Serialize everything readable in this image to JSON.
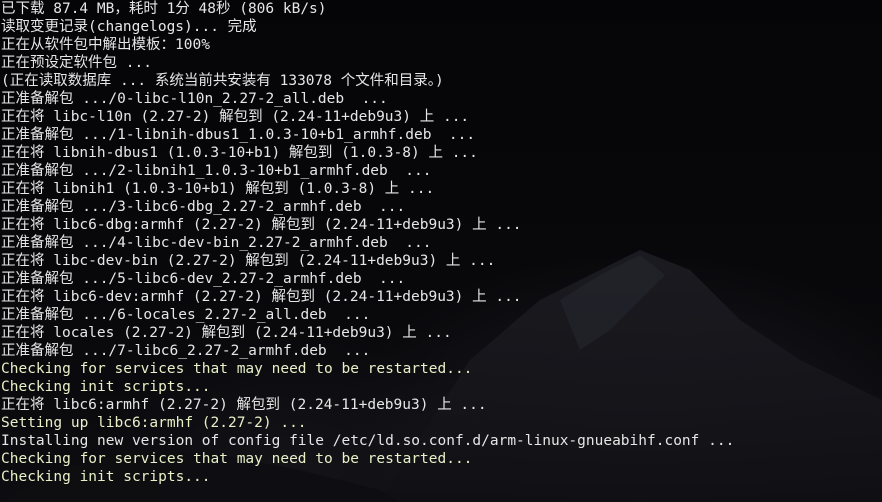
{
  "terminal": {
    "lines": [
      {
        "text": "已下载 87.4 MB，耗时 1分 48秒 (806 kB/s)",
        "tone": "white"
      },
      {
        "text": "读取变更记录(changelogs)... 完成",
        "tone": "white"
      },
      {
        "text": "正在从软件包中解出模板：100%",
        "tone": "white"
      },
      {
        "text": "正在预设定软件包 ...",
        "tone": "white"
      },
      {
        "text": "(正在读取数据库 ... 系统当前共安装有 133078 个文件和目录。)",
        "tone": "white"
      },
      {
        "text": "正准备解包 .../0-libc-l10n_2.27-2_all.deb  ...",
        "tone": "white"
      },
      {
        "text": "正在将 libc-l10n (2.27-2) 解包到 (2.24-11+deb9u3) 上 ...",
        "tone": "white"
      },
      {
        "text": "正准备解包 .../1-libnih-dbus1_1.0.3-10+b1_armhf.deb  ...",
        "tone": "white"
      },
      {
        "text": "正在将 libnih-dbus1 (1.0.3-10+b1) 解包到 (1.0.3-8) 上 ...",
        "tone": "white"
      },
      {
        "text": "正准备解包 .../2-libnih1_1.0.3-10+b1_armhf.deb  ...",
        "tone": "white"
      },
      {
        "text": "正在将 libnih1 (1.0.3-10+b1) 解包到 (1.0.3-8) 上 ...",
        "tone": "white"
      },
      {
        "text": "正准备解包 .../3-libc6-dbg_2.27-2_armhf.deb  ...",
        "tone": "white"
      },
      {
        "text": "正在将 libc6-dbg:armhf (2.27-2) 解包到 (2.24-11+deb9u3) 上 ...",
        "tone": "white"
      },
      {
        "text": "正准备解包 .../4-libc-dev-bin_2.27-2_armhf.deb  ...",
        "tone": "white"
      },
      {
        "text": "正在将 libc-dev-bin (2.27-2) 解包到 (2.24-11+deb9u3) 上 ...",
        "tone": "white"
      },
      {
        "text": "正准备解包 .../5-libc6-dev_2.27-2_armhf.deb  ...",
        "tone": "white"
      },
      {
        "text": "正在将 libc6-dev:armhf (2.27-2) 解包到 (2.24-11+deb9u3) 上 ...",
        "tone": "white"
      },
      {
        "text": "正准备解包 .../6-locales_2.27-2_all.deb  ...",
        "tone": "white"
      },
      {
        "text": "正在将 locales (2.27-2) 解包到 (2.24-11+deb9u3) 上 ...",
        "tone": "white"
      },
      {
        "text": "正准备解包 .../7-libc6_2.27-2_armhf.deb  ...",
        "tone": "white"
      },
      {
        "text": "Checking for services that may need to be restarted...",
        "tone": "green"
      },
      {
        "text": "Checking init scripts...",
        "tone": "green"
      },
      {
        "text": "正在将 libc6:armhf (2.27-2) 解包到 (2.24-11+deb9u3) 上 ...",
        "tone": "white"
      },
      {
        "text": "Setting up libc6:armhf (2.27-2) ...",
        "tone": "green"
      },
      {
        "text": "Installing new version of config file /etc/ld.so.conf.d/arm-linux-gnueabihf.conf ...",
        "tone": "white"
      },
      {
        "text": "Checking for services that may need to be restarted...",
        "tone": "green"
      },
      {
        "text": "Checking init scripts...",
        "tone": "green"
      }
    ]
  },
  "colors": {
    "background": "#060608",
    "text_white": "#e6e6e6",
    "text_green": "#e8f0c8"
  }
}
